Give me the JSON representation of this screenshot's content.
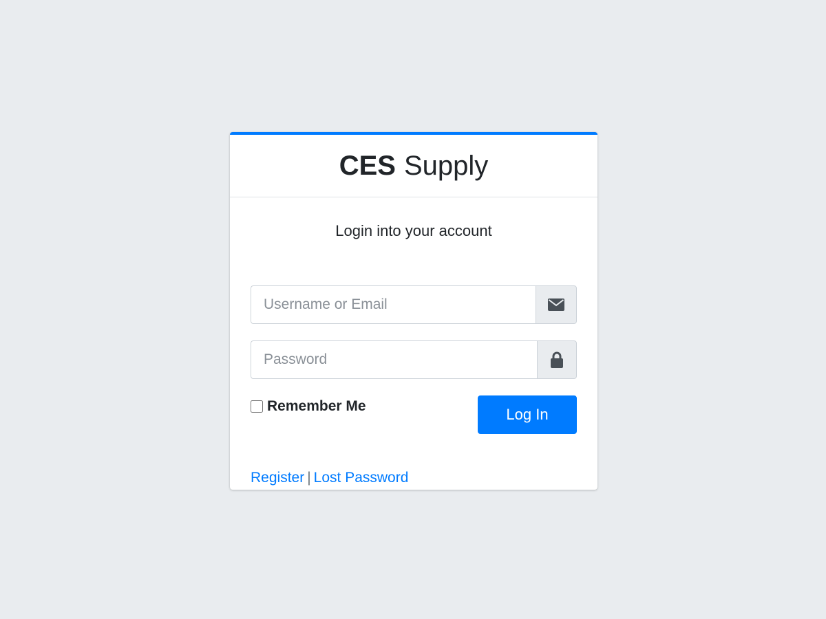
{
  "brand": {
    "bold": "CES",
    "light": "Supply"
  },
  "login": {
    "message": "Login into your account",
    "username_placeholder": "Username or Email",
    "password_placeholder": "Password",
    "remember_label": "Remember Me",
    "remember_checked": false,
    "submit_label": "Log In"
  },
  "links": {
    "register": "Register",
    "separator": "|",
    "lost_password": "Lost Password"
  },
  "icons": {
    "username": "envelope-icon",
    "password": "lock-icon"
  },
  "colors": {
    "accent": "#007bff",
    "background": "#e9ecef",
    "card": "#ffffff"
  }
}
